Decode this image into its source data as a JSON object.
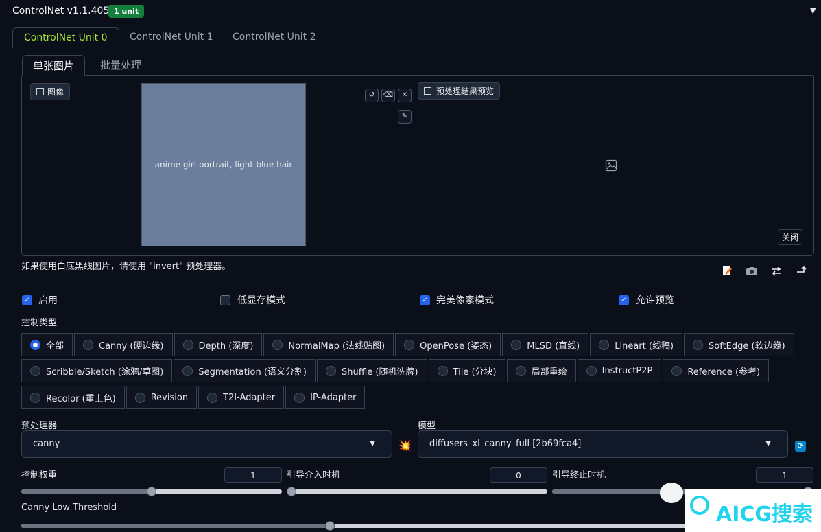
{
  "header": {
    "title": "ControlNet v1.1.405",
    "badge": "1 unit",
    "collapse_icon": "▼"
  },
  "unit_tabs": [
    {
      "label": "ControlNet Unit 0"
    },
    {
      "label": "ControlNet Unit 1"
    },
    {
      "label": "ControlNet Unit 2"
    }
  ],
  "input_tabs": [
    {
      "label": "单张图片"
    },
    {
      "label": "批量处理"
    }
  ],
  "image_input": {
    "label": "图像",
    "placeholder": "anime girl portrait, light-blue hair",
    "tools": {
      "rotate": "↺",
      "erase": "⌫",
      "clear": "✕",
      "brush": "✎"
    }
  },
  "preview": {
    "label": "预处理结果预览",
    "close_label": "关闭"
  },
  "hint": "如果使用白底黑线图片，请使用 \"invert\" 预处理器。",
  "checkboxes": [
    {
      "label": "启用",
      "checked": true
    },
    {
      "label": "低显存模式",
      "checked": false
    },
    {
      "label": "完美像素模式",
      "checked": true
    },
    {
      "label": "允许预览",
      "checked": true
    }
  ],
  "control_type": {
    "label": "控制类型",
    "selected": "全部",
    "rows": [
      [
        "全部",
        "Canny (硬边缘)",
        "Depth (深度)",
        "NormalMap (法线贴图)",
        "OpenPose (姿态)",
        "MLSD (直线)",
        "Lineart (线稿)",
        "SoftEdge (软边缘)"
      ],
      [
        "Scribble/Sketch (涂鸦/草图)",
        "Segmentation (语义分割)",
        "Shuffle (随机洗牌)",
        "Tile (分块)",
        "局部重绘",
        "InstructP2P",
        "Reference (参考)"
      ],
      [
        "Recolor (重上色)",
        "Revision",
        "T2I-Adapter",
        "IP-Adapter"
      ]
    ]
  },
  "preprocessor": {
    "label": "预处理器",
    "value": "canny",
    "run_icon": "💥"
  },
  "model": {
    "label": "模型",
    "value": "diffusers_xl_canny_full [2b69fca4]",
    "refresh_icon": "🔄"
  },
  "sliders": {
    "weight": {
      "label": "控制权重",
      "value": "1",
      "fraction": 0.5
    },
    "start": {
      "label": "引导介入时机",
      "value": "0",
      "fraction": 0.0
    },
    "end": {
      "label": "引导终止时机",
      "value": "1",
      "fraction": 1.0
    },
    "canny_low": {
      "label": "Canny Low Threshold",
      "fraction": 0.39
    }
  },
  "watermark": {
    "text": "AICG搜索"
  }
}
